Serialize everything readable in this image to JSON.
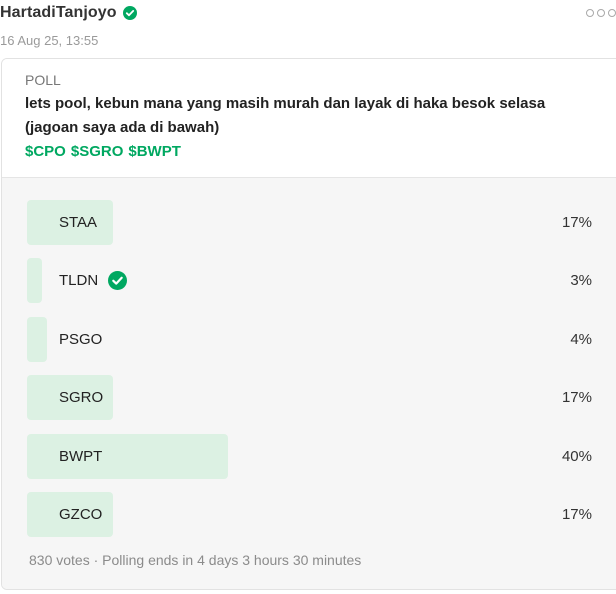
{
  "post": {
    "author": "HartadiTanjoyo",
    "timestamp": "16 Aug 25, 13:55"
  },
  "poll": {
    "label": "POLL",
    "question": "lets pool, kebun mana yang masih murah dan layak di haka besok selasa (jagoan saya ada di bawah)",
    "tags": [
      "$CPO",
      "$SGRO",
      "$BWPT"
    ],
    "options": [
      {
        "label": "STAA",
        "percent_text": "17%",
        "percent": 17,
        "selected": false
      },
      {
        "label": "TLDN",
        "percent_text": "3%",
        "percent": 3,
        "selected": true
      },
      {
        "label": "PSGO",
        "percent_text": "4%",
        "percent": 4,
        "selected": false
      },
      {
        "label": "SGRO",
        "percent_text": "17%",
        "percent": 17,
        "selected": false
      },
      {
        "label": "BWPT",
        "percent_text": "40%",
        "percent": 40,
        "selected": false
      },
      {
        "label": "GZCO",
        "percent_text": "17%",
        "percent": 17,
        "selected": false
      }
    ],
    "footer": "830 votes · Polling ends in 4 days 3 hours 30 minutes"
  },
  "colors": {
    "accent": "#00a861",
    "bar": "#dcf1e3"
  },
  "icons": {
    "verified": "verified-check-icon",
    "more": "more-dots-icon",
    "selected": "check-circle-icon"
  }
}
